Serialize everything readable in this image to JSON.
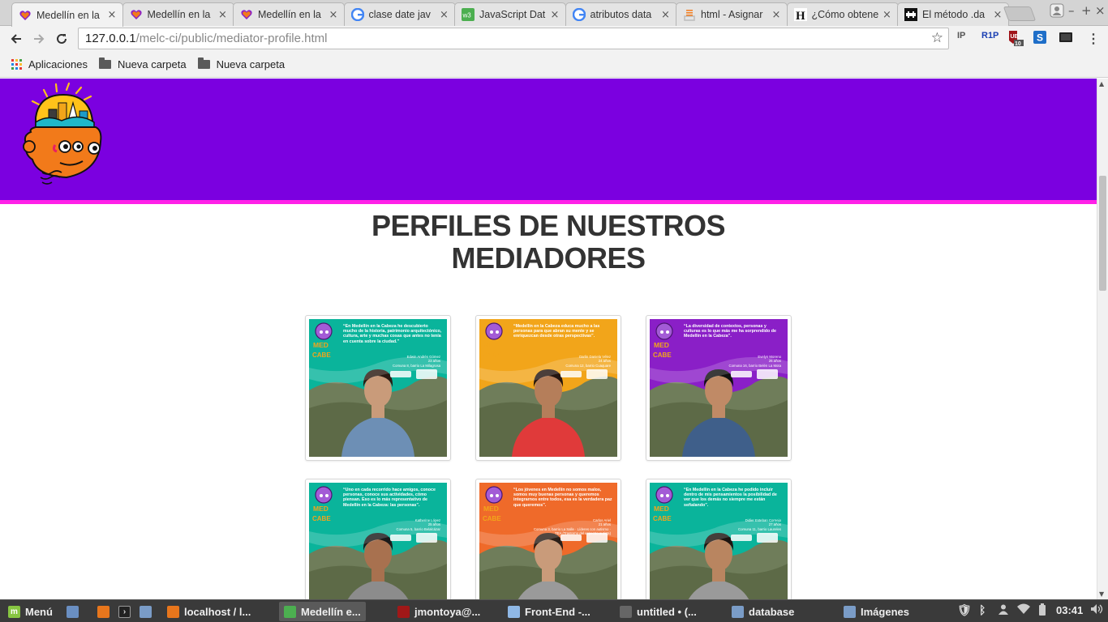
{
  "browser": {
    "tabs": [
      {
        "title": "Medellín en la",
        "icon": "heart-icon",
        "active": true
      },
      {
        "title": "Medellín en la",
        "icon": "heart-icon",
        "active": false
      },
      {
        "title": "Medellín en la",
        "icon": "heart-icon",
        "active": false
      },
      {
        "title": "clase date jav",
        "icon": "google-icon",
        "active": false
      },
      {
        "title": "JavaScript Dat",
        "icon": "w3schools-icon",
        "active": false
      },
      {
        "title": "atributos data",
        "icon": "google-icon",
        "active": false
      },
      {
        "title": "html - Asignar",
        "icon": "stackoverflow-icon",
        "active": false
      },
      {
        "title": "¿Cómo obtene",
        "icon": "h-icon",
        "active": false
      },
      {
        "title": "El método .da",
        "icon": "space-invader-icon",
        "active": false
      }
    ],
    "url_host": "127.0.0.1",
    "url_path": "/melc-ci/public/mediator-profile.html",
    "extensions": [
      "IP",
      "R1P",
      "UB",
      "S",
      "cast"
    ],
    "ub_count": "10",
    "bookmarks": [
      {
        "label": "Aplicaciones",
        "icon": "apps-grid-icon"
      },
      {
        "label": "Nueva carpeta",
        "icon": "folder-icon"
      },
      {
        "label": "Nueva carpeta",
        "icon": "folder-icon"
      }
    ]
  },
  "page": {
    "title_line1": "PERFILES DE NUESTROS",
    "title_line2": "MEDIADORES",
    "colors": {
      "header": "#7b00e0",
      "header_border": "#ff20e8"
    },
    "profiles": [
      {
        "bg": "#0ab49b",
        "shirt": "#6d8fb5",
        "quote": "“En Medellín en la Cabeza he descubierto mucho de la historia, patrimonio arquitectónico, cultura, arte y muchas cosas que antes no tenía en cuenta sobre la ciudad.”",
        "name": "Edwin Andrés Gómez",
        "age": "23 años",
        "place": "Comuna 8, barrio La Milagrosa"
      },
      {
        "bg": "#f2a51a",
        "shirt": "#e03a3a",
        "quote": "“Medellín en la Cabeza educa mucho a las personas para que abran su mente y se enriquezcan desde otras perspectivas”.",
        "name": "Darlin Daniela Vélez",
        "age": "24 años",
        "place": "Comuna 12, barrio Cuaquare"
      },
      {
        "bg": "#8a1fc7",
        "shirt": "#3f5f8a",
        "quote": "“La diversidad de contextos, personas y culturas es lo que más me ha sorprendido de Medellín en la Cabeza”.",
        "name": "Evelyn Moreno",
        "age": "26 años",
        "place": "Comuna 16, barrio Belén La Mota"
      },
      {
        "bg": "#0ab49b",
        "shirt": "#8c8c8c",
        "quote": "“Uno en cada recorrido hace amigos, conoce personas, conoce sus actividades, cómo piensan. Eso es lo más representativo de Medellín en la Cabeza: las personas”.",
        "name": "Katherine López",
        "age": "25 años",
        "place": "Comuna 5, barrio Belalcázar"
      },
      {
        "bg": "#ef6a2a",
        "shirt": "#9a9a9a",
        "quote": "“Los jóvenes en Medellín no somos malos, somos muy buenas personas y queremos integrarnos entre todos, esa es la verdadera paz que queremos”.",
        "name": "Carlos Ariel",
        "age": "21 años",
        "place": "Comuna 3, barrio La Salle · Líderes con autismo · TEA (Trastorno del espectro autista)"
      },
      {
        "bg": "#0ab49b",
        "shirt": "#9a9a9a",
        "quote": "“En Medellín en la Cabeza he podido incluir dentro de mis pensamientos la posibilidad de ver que los demás no siempre me están señalando”.",
        "name": "Didier Esteban Cornejo",
        "age": "27 años",
        "place": "Comuna 11, barrio Laureles"
      }
    ]
  },
  "taskbar": {
    "menu_label": "Menú",
    "tasks": [
      {
        "label": "localhost / l...",
        "icon": "firefox-icon"
      },
      {
        "label": "Medellín e...",
        "icon": "chrome-icon",
        "active": true
      },
      {
        "label": "jmontoya@...",
        "icon": "terminal-icon"
      },
      {
        "label": "Front-End -...",
        "icon": "cube-icon"
      },
      {
        "label": "untitled • (...",
        "icon": "editor-icon"
      },
      {
        "label": "database",
        "icon": "folder-icon"
      },
      {
        "label": "Imágenes",
        "icon": "folder-icon"
      }
    ],
    "clock": "03:41"
  }
}
